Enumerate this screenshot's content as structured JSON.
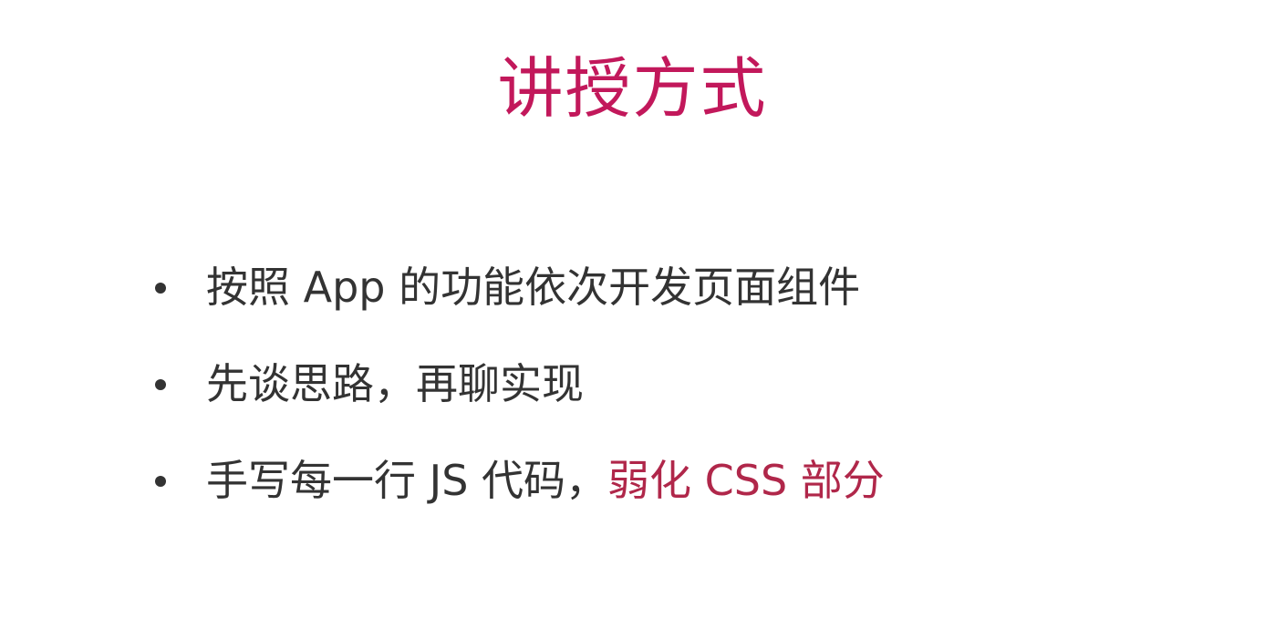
{
  "slide": {
    "title": "讲授方式",
    "bullets": [
      {
        "text": "按照 App 的功能依次开发页面组件"
      },
      {
        "text": "先谈思路，再聊实现"
      },
      {
        "text": "手写每一行 JS 代码，",
        "highlight": "弱化 CSS 部分"
      }
    ]
  },
  "colors": {
    "title": "#c2185b",
    "body_text": "#333333",
    "highlight": "#b0274a",
    "background": "#ffffff"
  }
}
